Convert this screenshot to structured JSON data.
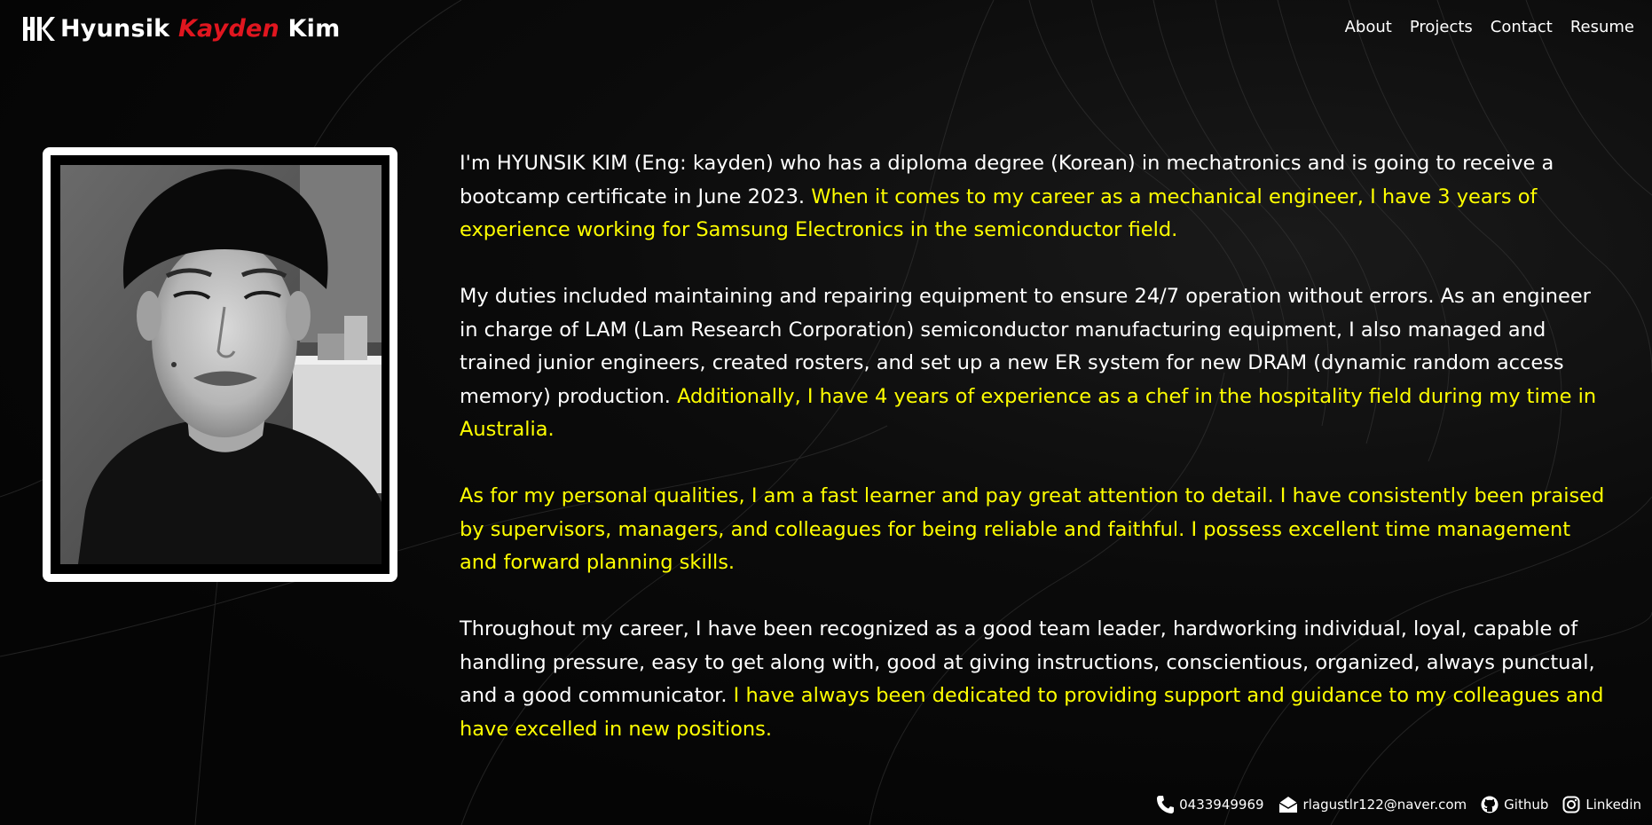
{
  "header": {
    "logo_icon": "hk-monogram-icon",
    "name_first": "Hyunsik",
    "name_middle": "Kayden",
    "name_last": "Kim",
    "nav": [
      {
        "label": "About"
      },
      {
        "label": "Projects"
      },
      {
        "label": "Contact"
      },
      {
        "label": "Resume"
      }
    ]
  },
  "about": {
    "p1_a": "I'm HYUNSIK KIM (Eng: kayden) who has a diploma degree (Korean) in mechatronics and is going to receive a bootcamp certificate in June 2023. ",
    "p1_b": "When it comes to my career as a mechanical engineer, I have 3 years of experience working for Samsung Electronics in the semiconductor field.",
    "p2_a": "My duties included maintaining and repairing equipment to ensure 24/7 operation without errors. As an engineer in charge of LAM (Lam Research Corporation) semiconductor manufacturing equipment, I also managed and trained junior engineers, created rosters, and set up a new ER system for new DRAM (dynamic random access memory) production. ",
    "p2_b": "Additionally, I have 4 years of experience as a chef in the hospitality field during my time in Australia.",
    "p3_b": "As for my personal qualities, I am a fast learner and pay great attention to detail. I have consistently been praised by supervisors, managers, and colleagues for being reliable and faithful. I possess excellent time management and forward planning skills.",
    "p4_a": "Throughout my career, I have been recognized as a good team leader, hardworking individual, loyal, capable of handling pressure, easy to get along with, good at giving instructions, conscientious, organized, always punctual, and a good communicator. ",
    "p4_b": "I have always been dedicated to providing support and guidance to my colleagues and have excelled in new positions."
  },
  "footer": {
    "phone": {
      "icon": "phone-icon",
      "label": "0433949969"
    },
    "email": {
      "icon": "envelope-icon",
      "label": "rlagustlr122@naver.com"
    },
    "github": {
      "icon": "github-icon",
      "label": "Github"
    },
    "linkedin": {
      "icon": "instagram-icon",
      "label": "Linkedin"
    }
  },
  "colors": {
    "background": "#050505",
    "text": "#ffffff",
    "highlight": "#ffff00",
    "accent": "#e0161f"
  }
}
